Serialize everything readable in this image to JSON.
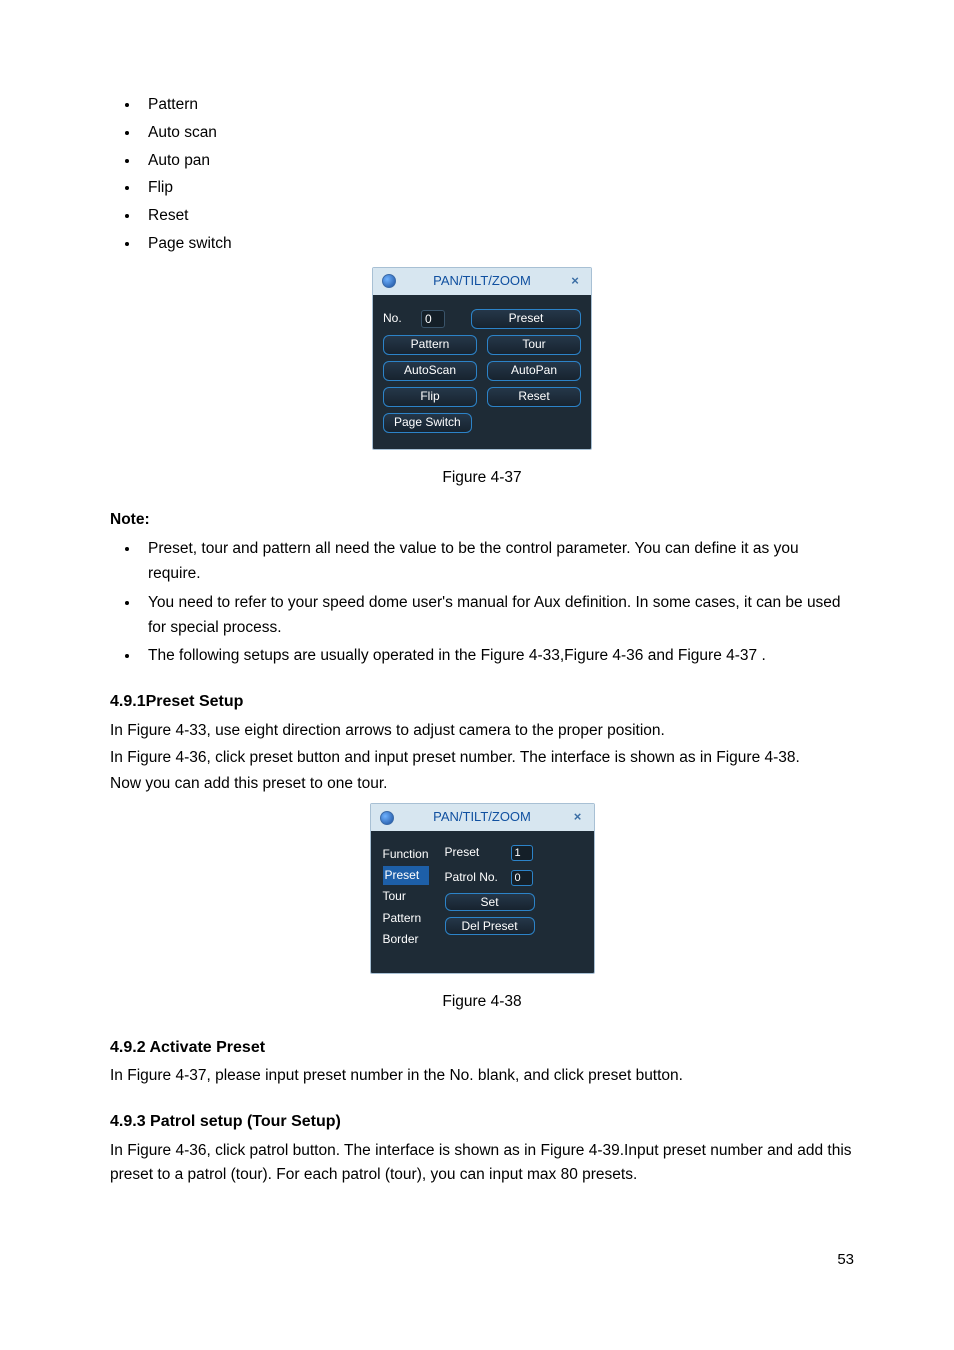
{
  "top_bullets": [
    "Pattern",
    "Auto scan",
    "Auto pan",
    "Flip",
    "Reset",
    "Page switch"
  ],
  "panel1": {
    "title": "PAN/TILT/ZOOM",
    "no_label": "No.",
    "no_value": "0",
    "btn_preset": "Preset",
    "btn_pattern": "Pattern",
    "btn_tour": "Tour",
    "btn_autoscan": "AutoScan",
    "btn_autopan": "AutoPan",
    "btn_flip": "Flip",
    "btn_reset": "Reset",
    "btn_page_switch": "Page Switch"
  },
  "fig1_caption": "Figure 4-37",
  "note_label": "Note:",
  "note_items": [
    "Preset, tour and pattern all need the value to be the control parameter. You can define it as you require.",
    "You need to refer to your speed dome user's manual for Aux definition. In some cases, it can be used for special process.",
    "The following setups are usually operated in the Figure 4-33,Figure 4-36 and Figure 4-37 ."
  ],
  "sect1_head": "4.9.1Preset Setup",
  "sect1_p1": "In Figure 4-33, use eight direction arrows to adjust camera to the proper position.",
  "sect1_p2": "In Figure 4-36, click preset button and input preset number. The interface is shown as in Figure 4-38.",
  "sect1_p3": "Now you can add this preset to one tour.",
  "panel2": {
    "title": "PAN/TILT/ZOOM",
    "fn_label": "Function",
    "fn_items": [
      "Preset",
      "Tour",
      "Pattern",
      "Border"
    ],
    "preset_label": "Preset",
    "preset_value": "1",
    "patrol_label": "Patrol No.",
    "patrol_value": "0",
    "btn_set": "Set",
    "btn_del": "Del Preset"
  },
  "fig2_caption": "Figure 4-38",
  "sect2_head": "4.9.2 Activate Preset",
  "sect2_p1": "In Figure 4-37, please input preset number in the No. blank, and click preset button.",
  "sect3_head": "4.9.3 Patrol setup (Tour Setup)",
  "sect3_p1": "In Figure 4-36, click patrol button. The interface is shown as in Figure 4-39.Input preset number and add this preset to a patrol (tour). For each patrol (tour), you can input max 80 presets.",
  "page_num": "53"
}
